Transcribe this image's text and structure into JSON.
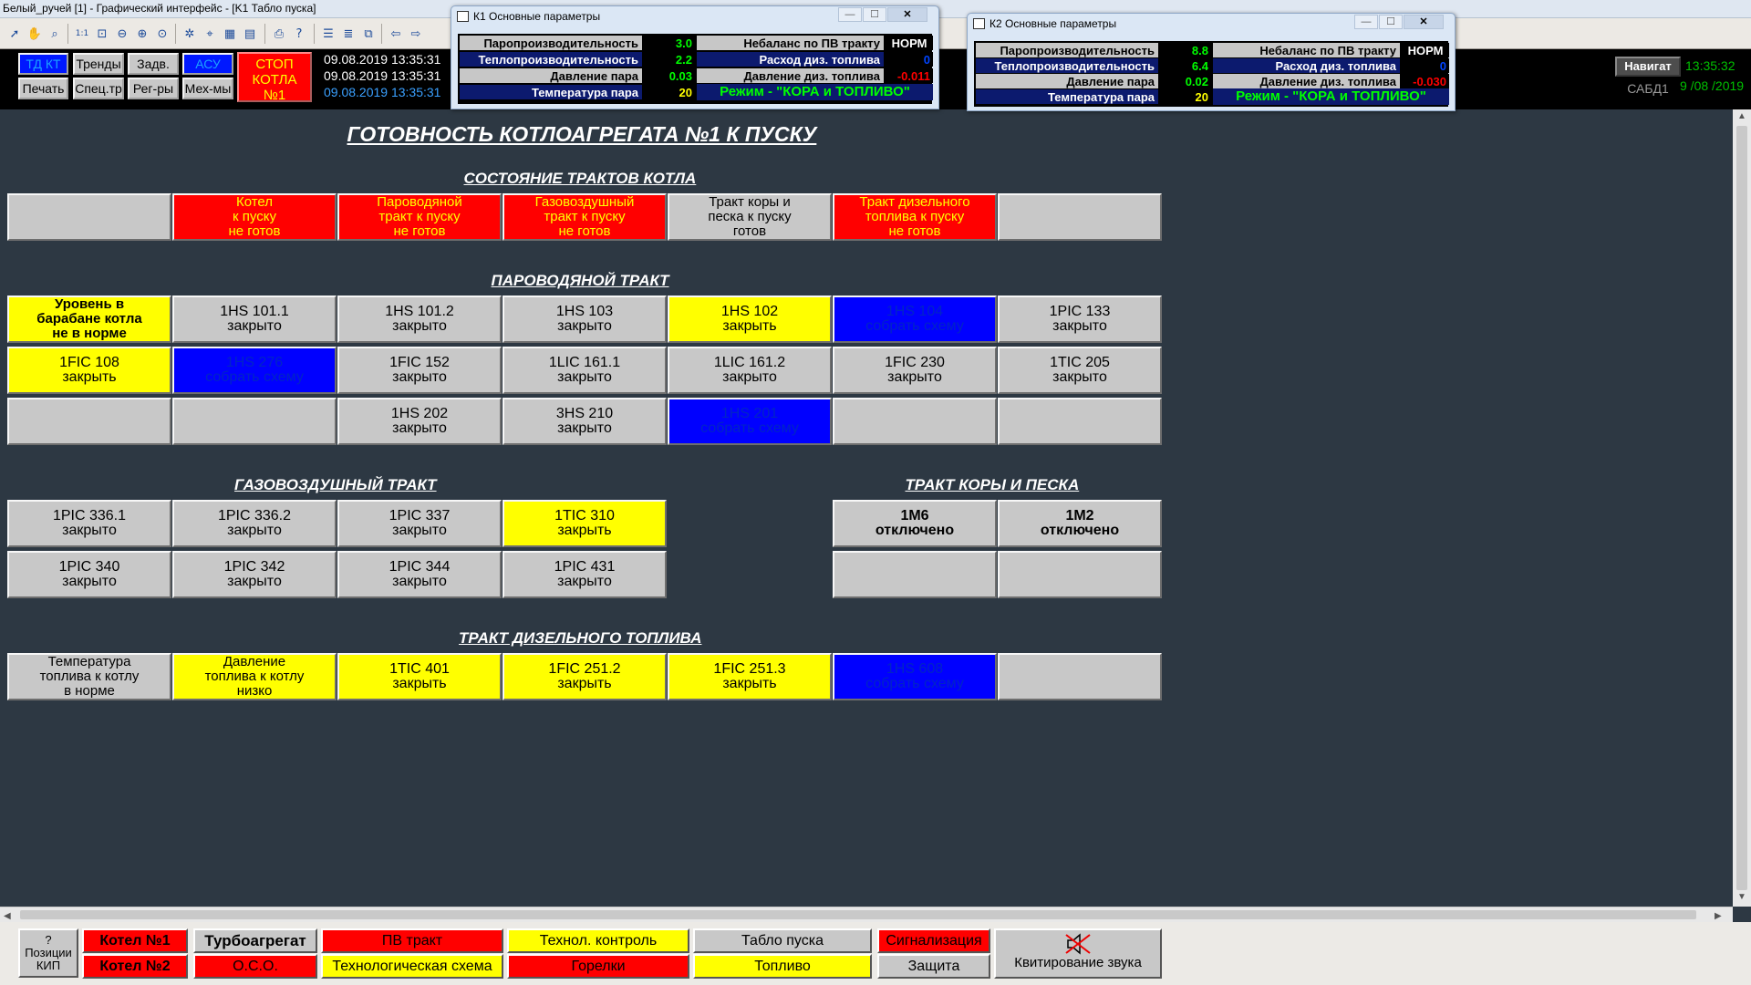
{
  "window_title": "Белый_ручей [1] - Графический интерфейс - [K1 Табло пуска]",
  "ctrl_buttons": {
    "td_kt": "ТД КТ",
    "trends": "Тренды",
    "zadv": "Задв.",
    "asu": "АСУ",
    "print": "Печать",
    "spec": "Спец.тр",
    "regs": "Рег-ры",
    "mech": "Мех-мы"
  },
  "stop_button": {
    "line1": "СТОП",
    "line2": "КОТЛА",
    "line3": "№1"
  },
  "datetimes": [
    "09.08.2019 13:35:31",
    "09.08.2019 13:35:31",
    "09.08.2019 13:35:31"
  ],
  "nav_button": "Навигат",
  "sabd": "САБД1",
  "clock": {
    "time": "13:35:32",
    "date": "9 /08 /2019"
  },
  "popup_k1": {
    "title": "К1 Основные параметры",
    "rows": [
      {
        "label": "Паропроизводительность",
        "value": "3.0",
        "color": "#00ff00"
      },
      {
        "label": "Теплопроизводительность",
        "value": "2.2",
        "color": "#00ff00"
      },
      {
        "label": "Давление пара",
        "value": "0.03",
        "color": "#00ff00"
      },
      {
        "label": "Температура пара",
        "value": "20",
        "color": "#ffff00"
      }
    ],
    "right": [
      {
        "label": "Небаланс по ПВ тракту",
        "norm": "НОРМ"
      },
      {
        "label": "Расход диз. топлива",
        "value": "0",
        "color": "#0044ff"
      },
      {
        "label": "Давление диз. топлива",
        "value": "-0.011",
        "color": "#ff0000"
      }
    ],
    "mode": "Режим - \"КОРА и ТОПЛИВО\""
  },
  "popup_k2": {
    "title": "К2 Основные параметры",
    "rows": [
      {
        "label": "Паропроизводительность",
        "value": "8.8",
        "color": "#00ff00"
      },
      {
        "label": "Теплопроизводительность",
        "value": "6.4",
        "color": "#00ff00"
      },
      {
        "label": "Давление пара",
        "value": "0.02",
        "color": "#00ff00"
      },
      {
        "label": "Температура пара",
        "value": "20",
        "color": "#ffff00"
      }
    ],
    "right": [
      {
        "label": "Небаланс по ПВ тракту",
        "norm": "НОРМ"
      },
      {
        "label": "Расход диз. топлива",
        "value": "0",
        "color": "#0044ff"
      },
      {
        "label": "Давление диз. топлива",
        "value": "-0.030",
        "color": "#ff0000"
      }
    ],
    "mode": "Режим - \"КОРА и ТОПЛИВО\""
  },
  "main_title": "ГОТОВНОСТЬ КОТЛОАГРЕГАТА №1 К ПУСКУ",
  "sections": {
    "state": "СОСТОЯНИЕ ТРАКТОВ КОТЛА",
    "water": "ПАРОВОДЯНОЙ ТРАКТ",
    "gas": "ГАЗОВОЗДУШНЫЙ ТРАКТ",
    "bark": "ТРАКТ КОРЫ И ПЕСКА",
    "diesel": "ТРАКТ ДИЗЕЛЬНОГО ТОПЛИВА"
  },
  "state_cells": [
    {
      "text": "",
      "color": "gray"
    },
    {
      "text": "Котел\nк пуску\nне готов",
      "color": "red"
    },
    {
      "text": "Пароводяной\nтракт к пуску\nне готов",
      "color": "red"
    },
    {
      "text": "Газовоздушный\nтракт к пуску\nне готов",
      "color": "red"
    },
    {
      "text": "Тракт коры и\nпеска к пуску\nготов",
      "color": "gray"
    },
    {
      "text": "Тракт дизельного\nтоплива к пуску\nне готов",
      "color": "red"
    },
    {
      "text": "",
      "color": "gray"
    }
  ],
  "water_cells": [
    [
      {
        "text": "Уровень в\nбарабане котла\nне в норме",
        "color": "yellow",
        "bold": true
      },
      {
        "text": "1HS 101.1\nзакрыто",
        "color": "gray"
      },
      {
        "text": "1HS 101.2\nзакрыто",
        "color": "gray"
      },
      {
        "text": "1HS 103\nзакрыто",
        "color": "gray"
      },
      {
        "text": "1HS 102\nзакрыть",
        "color": "yellow"
      },
      {
        "text": "1HS 104\nсобрать схему",
        "color": "blue"
      },
      {
        "text": "1PIC 133\nзакрыто",
        "color": "gray"
      }
    ],
    [
      {
        "text": "1FIC 108\nзакрыть",
        "color": "yellow"
      },
      {
        "text": "1HS 276\nсобрать схему",
        "color": "blue"
      },
      {
        "text": "1FIC 152\nзакрыто",
        "color": "gray"
      },
      {
        "text": "1LIC 161.1\nзакрыто",
        "color": "gray"
      },
      {
        "text": "1LIC 161.2\nзакрыто",
        "color": "gray"
      },
      {
        "text": "1FIC 230\nзакрыто",
        "color": "gray"
      },
      {
        "text": "1TIC 205\nзакрыто",
        "color": "gray"
      }
    ],
    [
      {
        "text": "",
        "color": "gray"
      },
      {
        "text": "",
        "color": "gray"
      },
      {
        "text": "1HS 202\nзакрыто",
        "color": "gray"
      },
      {
        "text": "3HS 210\nзакрыто",
        "color": "gray"
      },
      {
        "text": "1HS 201\nсобрать схему",
        "color": "blue"
      },
      {
        "text": "",
        "color": "gray"
      },
      {
        "text": "",
        "color": "gray"
      }
    ]
  ],
  "gas_cells": [
    [
      {
        "text": "1PIC 336.1\nзакрыто",
        "color": "gray"
      },
      {
        "text": "1PIC 336.2\nзакрыто",
        "color": "gray"
      },
      {
        "text": "1PIC 337\nзакрыто",
        "color": "gray"
      },
      {
        "text": "1TIC 310\nзакрыть",
        "color": "yellow"
      }
    ],
    [
      {
        "text": "1PIC 340\nзакрыто",
        "color": "gray"
      },
      {
        "text": "1PIC 342\nзакрыто",
        "color": "gray"
      },
      {
        "text": "1PIC 344\nзакрыто",
        "color": "gray"
      },
      {
        "text": "1PIC 431\nзакрыто",
        "color": "gray"
      }
    ]
  ],
  "bark_cells": [
    [
      {
        "text": "1M6\nотключено",
        "color": "gray",
        "bold": true
      },
      {
        "text": "1M2\nотключено",
        "color": "gray",
        "bold": true
      }
    ],
    [
      {
        "text": "",
        "color": "gray"
      },
      {
        "text": "",
        "color": "gray"
      }
    ]
  ],
  "diesel_cells": [
    {
      "text": "Температура\nтоплива к котлу\nв норме",
      "color": "gray"
    },
    {
      "text": "Давление\nтоплива к котлу\nнизко",
      "color": "yellow"
    },
    {
      "text": "1TIC 401\nзакрыть",
      "color": "yellow"
    },
    {
      "text": "1FIC 251.2\nзакрыть",
      "color": "yellow"
    },
    {
      "text": "1FIC 251.3\nзакрыть",
      "color": "yellow"
    },
    {
      "text": "1HS 608\nсобрать схему",
      "color": "blue"
    },
    {
      "text": "",
      "color": "gray"
    }
  ],
  "bottom": {
    "kip_q": "?",
    "kip_1": "Позиции",
    "kip_2": "КИП",
    "kotel1": "Котел №1",
    "kotel2": "Котел №2",
    "turbo": "Турбоагрегат",
    "oso": "О.С.О.",
    "pv": "ПВ тракт",
    "tech_scheme": "Технологическая схема",
    "tech_control": "Технол. контроль",
    "burners": "Горелки",
    "launch_board": "Табло пуска",
    "fuel": "Топливо",
    "alarm": "Сигнализация",
    "protect": "Защита",
    "ack_sound": "Квитирование звука"
  }
}
